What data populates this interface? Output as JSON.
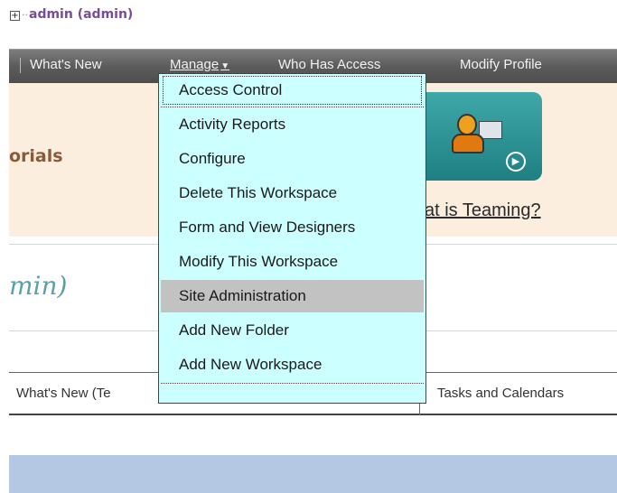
{
  "tree": {
    "toggle_glyph": "+",
    "user_link": "admin (admin)"
  },
  "navbar": {
    "items": [
      {
        "label": "What's New"
      },
      {
        "label": "Manage",
        "caret": "▼"
      },
      {
        "label": "Who Has Access"
      },
      {
        "label": "Modify Profile"
      }
    ]
  },
  "banner": {
    "tutorials_heading": "orials",
    "video_tile_icon": "person-document-video-icon",
    "play_glyph": "▶",
    "teaming_link": "at is Teaming?"
  },
  "workspace": {
    "title": "min)"
  },
  "tabs": [
    {
      "label": "What's New (Te"
    },
    {
      "label": "Tasks and Calendars"
    }
  ],
  "manage_menu": {
    "items": [
      {
        "label": "Access Control"
      },
      {
        "label": "Activity Reports"
      },
      {
        "label": "Configure"
      },
      {
        "label": "Delete This Workspace"
      },
      {
        "label": "Form and View Designers"
      },
      {
        "label": "Modify This Workspace"
      },
      {
        "label": "Site Administration"
      },
      {
        "label": "Add New Folder"
      },
      {
        "label": "Add New Workspace"
      }
    ],
    "highlighted": "Site Administration"
  },
  "colors": {
    "menu_bg": "#ccffff",
    "menu_highlight": "#c2c2c2",
    "navbar_bg": "#5c5c5c",
    "banner_bg": "#fbeedf",
    "accent_teal": "#2a8c8f",
    "user_link": "#7a4a9a",
    "footer_bar": "#b4c8e4"
  }
}
